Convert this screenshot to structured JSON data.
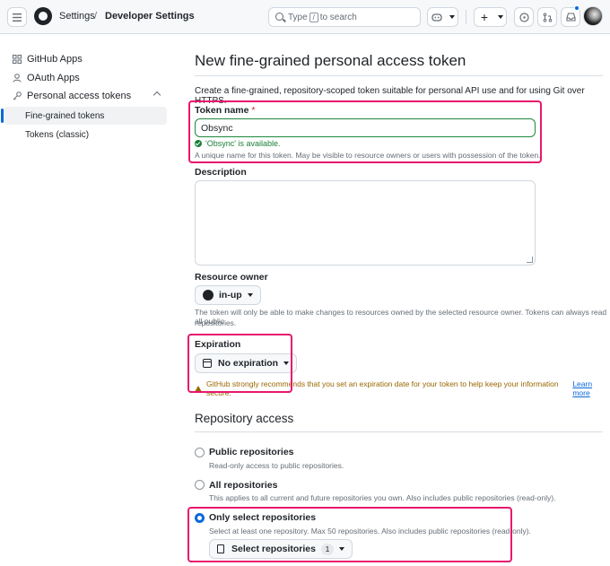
{
  "header": {
    "breadcrumb_settings": "Settings",
    "breadcrumb_separator": "/",
    "breadcrumb_developer": "Developer Settings",
    "search_prefix": "Type",
    "search_key": "/",
    "search_suffix": "to search",
    "plus_label": "+",
    "icons": [
      "menu-icon",
      "github-logo-icon",
      "search-icon",
      "copilot-icon",
      "plus-icon",
      "issues-icon",
      "pull-requests-icon",
      "inbox-icon"
    ],
    "accent_color": "#0969da"
  },
  "sidebar": {
    "items": [
      {
        "label": "GitHub Apps",
        "icon": "apps-icon"
      },
      {
        "label": "OAuth Apps",
        "icon": "person-icon"
      },
      {
        "label": "Personal access tokens",
        "icon": "key-icon"
      },
      {
        "label": "Fine-grained tokens"
      },
      {
        "label": "Tokens (classic)"
      }
    ]
  },
  "main": {
    "title": "New fine-grained personal access token",
    "intro": "Create a fine-grained, repository-scoped token suitable for personal API use and for using Git over HTTPS.",
    "token_name": {
      "label": "Token name",
      "required_mark": "*",
      "value": "Obsync",
      "available_msg": "'Obsync' is available.",
      "hint": "A unique name for this token. May be visible to resource owners or users with possession of the token."
    },
    "description": {
      "label": "Description",
      "value": ""
    },
    "resource_owner": {
      "label": "Resource owner",
      "value": "in-up",
      "hint_line1": "The token will only be able to make changes to resources owned by the selected resource owner. Tokens can always read all public",
      "hint_line2": "repositories."
    },
    "expiration": {
      "label": "Expiration",
      "value": "No expiration",
      "warning": "GitHub strongly recommends that you set an expiration date for your token to help keep your information secure.",
      "learn_more": "Learn more",
      "warning_color": "#9a6700"
    },
    "repository_access": {
      "title": "Repository access",
      "options": [
        {
          "label": "Public repositories",
          "desc": "Read-only access to public repositories.",
          "checked": false
        },
        {
          "label": "All repositories",
          "desc": "This applies to all current and future repositories you own. Also includes public repositories (read-only).",
          "checked": false
        },
        {
          "label": "Only select repositories",
          "desc": "Select at least one repository. Max 50 repositories. Also includes public repositories (read-only).",
          "checked": true
        }
      ],
      "select_button": "Select repositories",
      "select_count": "1"
    },
    "highlight_color": "#e8186d"
  }
}
